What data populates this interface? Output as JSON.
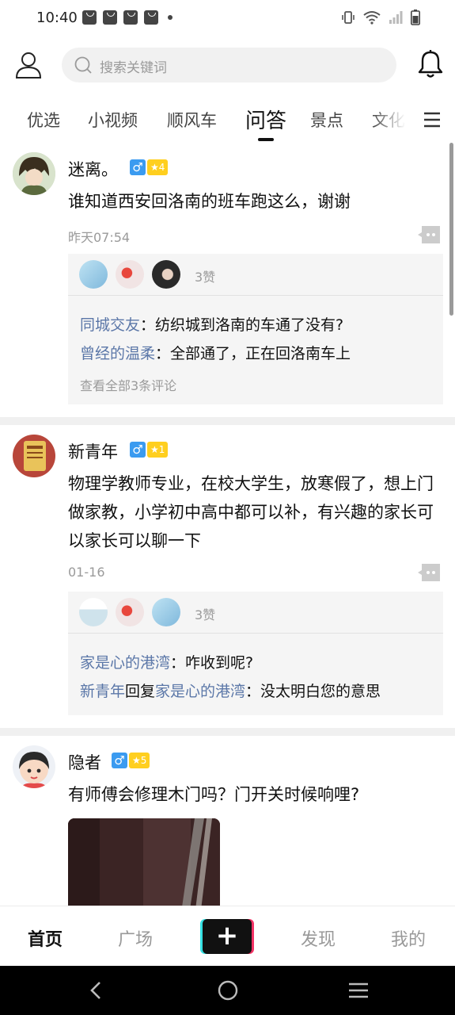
{
  "status_bar": {
    "time": "10:40",
    "notifications": [
      "bag-icon",
      "bag-icon",
      "bag-icon",
      "bag-icon"
    ],
    "indicators": [
      "vibrate-icon",
      "wifi-icon",
      "signal-icon",
      "battery-icon"
    ]
  },
  "header": {
    "search_placeholder": "搜索关键词"
  },
  "tabs": [
    {
      "label": "优选",
      "active": false
    },
    {
      "label": "小视频",
      "active": false
    },
    {
      "label": "顺风车",
      "active": false
    },
    {
      "label": "问答",
      "active": true
    },
    {
      "label": "景点",
      "active": false
    },
    {
      "label": "文化",
      "active": false
    }
  ],
  "posts": [
    {
      "author": "迷离。",
      "gender": "♂",
      "level": "★4",
      "text": "谁知道西安回洛南的班车跑这么，谢谢",
      "time": "昨天07:54",
      "likes": "3赞",
      "comments": [
        {
          "user": "同城交友",
          "text": "：纺织城到洛南的车通了没有?"
        },
        {
          "user": "曾经的温柔",
          "text": "：全部通了，正在回洛南车上"
        }
      ],
      "view_all": "查看全部3条评论"
    },
    {
      "author": "新青年",
      "gender": "♂",
      "level": "★1",
      "text": "物理学教师专业，在校大学生，放寒假了，想上门做家教，小学初中高中都可以补，有兴趣的家长可以家长可以聊一下",
      "time": "01-16",
      "likes": "3赞",
      "comments": [
        {
          "user": "家是心的港湾",
          "text": "：咋收到呢?"
        },
        {
          "user": "新青年",
          "reply_word": "回复",
          "reply_to": "家是心的港湾",
          "text": "：没太明白您的意思"
        }
      ]
    },
    {
      "author": "隐者",
      "gender": "♂",
      "level": "★5",
      "text": "有师傅会修理木门吗？门开关时候响哩?"
    }
  ],
  "bottom_nav": {
    "home": "首页",
    "square": "广场",
    "post": "+",
    "discover": "发现",
    "mine": "我的"
  },
  "colors": {
    "accent_blue": "#3b9bf0",
    "level_yellow": "#ffcf1f",
    "comment_user": "#5b77a8"
  }
}
